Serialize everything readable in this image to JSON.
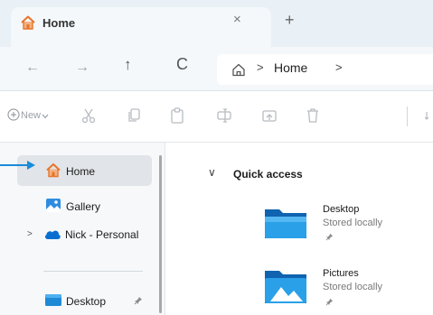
{
  "tab": {
    "title": "Home",
    "close": "×",
    "new_tab": "+"
  },
  "nav": {
    "back": "←",
    "forward": "→",
    "up": "↑",
    "refresh": "C",
    "breadcrumb_sep": ">",
    "breadcrumb_home": "Home"
  },
  "toolbar": {
    "new_label": "New"
  },
  "sidebar": {
    "items": [
      {
        "label": "Home"
      },
      {
        "label": "Gallery"
      },
      {
        "label": "Nick - Personal",
        "expander": ">"
      },
      {
        "label": "Desktop"
      }
    ]
  },
  "content": {
    "section_title": "Quick access",
    "section_chevron": "∨",
    "folders": [
      {
        "name": "Desktop",
        "sub": "Stored locally"
      },
      {
        "name": "Pictures",
        "sub": "Stored locally"
      }
    ]
  },
  "colors": {
    "accent": "#0a84d6",
    "home_icon": "#e8742a",
    "callout": "#1a8cd8"
  }
}
